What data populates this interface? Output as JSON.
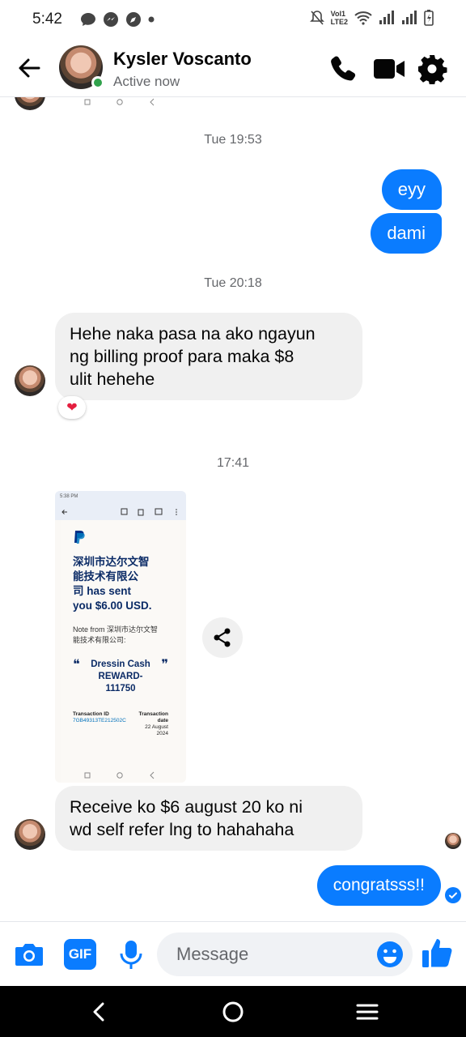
{
  "status_bar": {
    "time": "5:42",
    "network_label_top": "Vol1",
    "network_label_bottom": "LTE2"
  },
  "header": {
    "contact_name": "Kysler  Voscanto",
    "contact_status": "Active now"
  },
  "messages": {
    "ts1": "Tue 19:53",
    "out1": "eyy",
    "out2": "dami",
    "ts2": "Tue 20:18",
    "in1_line1": "Hehe naka pasa na ako ngayun",
    "in1_line2": "ng billing proof para maka $8",
    "in1_line3": "ulit hehehe",
    "in1_reaction": "❤",
    "ts3": "17:41",
    "in2_line1": "Receive ko $6 august 20 ko ni",
    "in2_line2": "wd self refer lng to hahahaha",
    "out3": "congratsss!!"
  },
  "attachment": {
    "status_time": "5:38 PM",
    "sender_line1": "深圳市达尔文智",
    "sender_line2": "能技术有限公",
    "sender_line3": "司 has sent",
    "sender_line4": "you $6.00 USD.",
    "note_line1": "Note from 深圳市达尔文智",
    "note_line2": "能技术有限公司:",
    "reward_line1": "Dressin Cash",
    "reward_line2": "REWARD-",
    "reward_line3": "111750",
    "txn_id_label": "Transaction ID",
    "txn_id_value": "7GB49313TE212502C",
    "txn_date_label1": "Transaction",
    "txn_date_label2": "date",
    "txn_date_value1": "22 August",
    "txn_date_value2": "2024"
  },
  "composer": {
    "placeholder": "Message",
    "gif_label": "GIF"
  },
  "colors": {
    "accent": "#0a7cff",
    "incoming_bubble": "#f0f0f0",
    "online": "#31a24c"
  }
}
